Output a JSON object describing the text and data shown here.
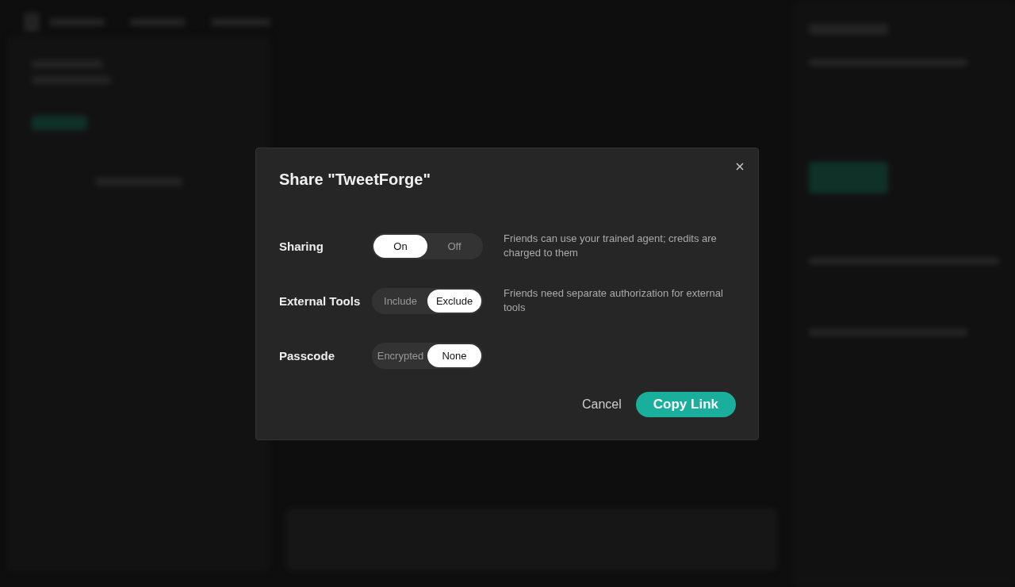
{
  "dialog": {
    "title": "Share \"TweetForge\"",
    "settings": [
      {
        "label": "Sharing",
        "options": [
          {
            "label": "On",
            "selected": true
          },
          {
            "label": "Off",
            "selected": false
          }
        ],
        "description": "Friends can use your trained agent; credits are charged to them"
      },
      {
        "label": "External Tools",
        "options": [
          {
            "label": "Include",
            "selected": false
          },
          {
            "label": "Exclude",
            "selected": true
          }
        ],
        "description": "Friends need separate authorization for external tools"
      },
      {
        "label": "Passcode",
        "options": [
          {
            "label": "Encrypted",
            "selected": false
          },
          {
            "label": "None",
            "selected": true
          }
        ]
      }
    ],
    "buttons": [
      {
        "label": "Cancel",
        "kind": "secondary"
      },
      {
        "label": "Copy Link",
        "kind": "primary"
      }
    ]
  }
}
